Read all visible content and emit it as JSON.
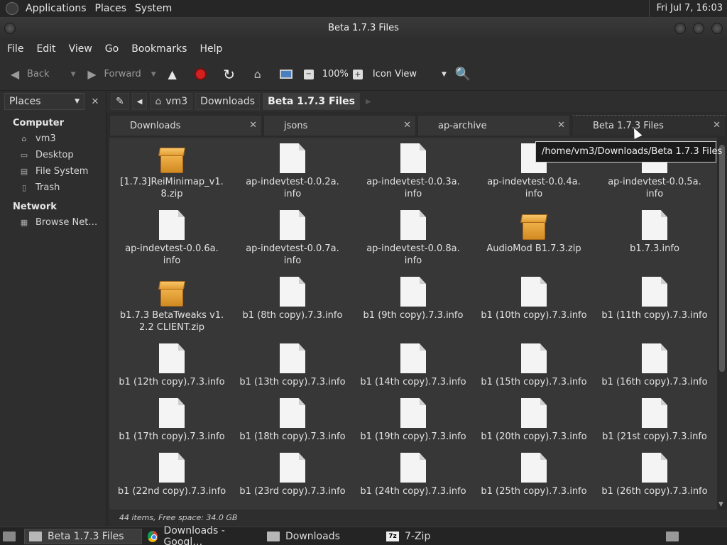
{
  "top_panel": {
    "menus": [
      "Applications",
      "Places",
      "System"
    ],
    "clock": "Fri Jul  7, 16:03"
  },
  "window": {
    "title": "Beta 1.7.3 Files"
  },
  "menubar": [
    "File",
    "Edit",
    "View",
    "Go",
    "Bookmarks",
    "Help"
  ],
  "toolbar": {
    "back": "Back",
    "forward": "Forward",
    "zoom": "100%",
    "view_mode": "Icon View"
  },
  "side_pane": {
    "selector": "Places",
    "computer_heading": "Computer",
    "computer_items": [
      "vm3",
      "Desktop",
      "File System",
      "Trash"
    ],
    "network_heading": "Network",
    "network_items": [
      "Browse Net…"
    ]
  },
  "pathbar": {
    "crumbs": [
      "vm3",
      "Downloads",
      "Beta 1.7.3 Files"
    ]
  },
  "tabs": [
    "Downloads",
    "jsons",
    "ap-archive",
    "Beta 1.7.3 Files"
  ],
  "tooltip": "/home/vm3/Downloads/Beta 1.7.3 Files",
  "files": [
    {
      "name": "[1.7.3]ReiMinimap_v1.\n8.zip",
      "kind": "zip"
    },
    {
      "name": "ap-indevtest-0.0.2a.\ninfo",
      "kind": "file"
    },
    {
      "name": "ap-indevtest-0.0.3a.\ninfo",
      "kind": "file"
    },
    {
      "name": "ap-indevtest-0.0.4a.\ninfo",
      "kind": "file"
    },
    {
      "name": "ap-indevtest-0.0.5a.\ninfo",
      "kind": "file"
    },
    {
      "name": "ap-indevtest-0.0.6a.\ninfo",
      "kind": "file"
    },
    {
      "name": "ap-indevtest-0.0.7a.\ninfo",
      "kind": "file"
    },
    {
      "name": "ap-indevtest-0.0.8a.\ninfo",
      "kind": "file"
    },
    {
      "name": "AudioMod B1.7.3.zip",
      "kind": "zip"
    },
    {
      "name": "b1.7.3.info",
      "kind": "file"
    },
    {
      "name": "b1.7.3 BetaTweaks v1.\n2.2 CLIENT.zip",
      "kind": "zip"
    },
    {
      "name": "b1 (8th copy).7.3.info",
      "kind": "file"
    },
    {
      "name": "b1 (9th copy).7.3.info",
      "kind": "file"
    },
    {
      "name": "b1 (10th copy).7.3.info",
      "kind": "file"
    },
    {
      "name": "b1 (11th copy).7.3.info",
      "kind": "file"
    },
    {
      "name": "b1 (12th copy).7.3.info",
      "kind": "file"
    },
    {
      "name": "b1 (13th copy).7.3.info",
      "kind": "file"
    },
    {
      "name": "b1 (14th copy).7.3.info",
      "kind": "file"
    },
    {
      "name": "b1 (15th copy).7.3.info",
      "kind": "file"
    },
    {
      "name": "b1 (16th copy).7.3.info",
      "kind": "file"
    },
    {
      "name": "b1 (17th copy).7.3.info",
      "kind": "file"
    },
    {
      "name": "b1 (18th copy).7.3.info",
      "kind": "file"
    },
    {
      "name": "b1 (19th copy).7.3.info",
      "kind": "file"
    },
    {
      "name": "b1 (20th copy).7.3.info",
      "kind": "file"
    },
    {
      "name": "b1 (21st copy).7.3.info",
      "kind": "file"
    },
    {
      "name": "b1 (22nd copy).7.3.info",
      "kind": "file"
    },
    {
      "name": "b1 (23rd copy).7.3.info",
      "kind": "file"
    },
    {
      "name": "b1 (24th copy).7.3.info",
      "kind": "file"
    },
    {
      "name": "b1 (25th copy).7.3.info",
      "kind": "file"
    },
    {
      "name": "b1 (26th copy).7.3.info",
      "kind": "file"
    }
  ],
  "status": "44 items, Free space: 34.0 GB",
  "taskbar": [
    {
      "label": "Beta 1.7.3 Files",
      "icon": "folder-icon",
      "active": true
    },
    {
      "label": "Downloads - Googl…",
      "icon": "chrome-icon",
      "active": false
    },
    {
      "label": "Downloads",
      "icon": "folder-icon",
      "active": false
    },
    {
      "label": "7-Zip",
      "icon": "sevenzip-icon",
      "active": false
    }
  ],
  "colors": {
    "panel": "#262626",
    "window": "#2e2e2e",
    "view": "#373737",
    "stop_red": "#d32020",
    "zip_orange": "#e39d32"
  }
}
